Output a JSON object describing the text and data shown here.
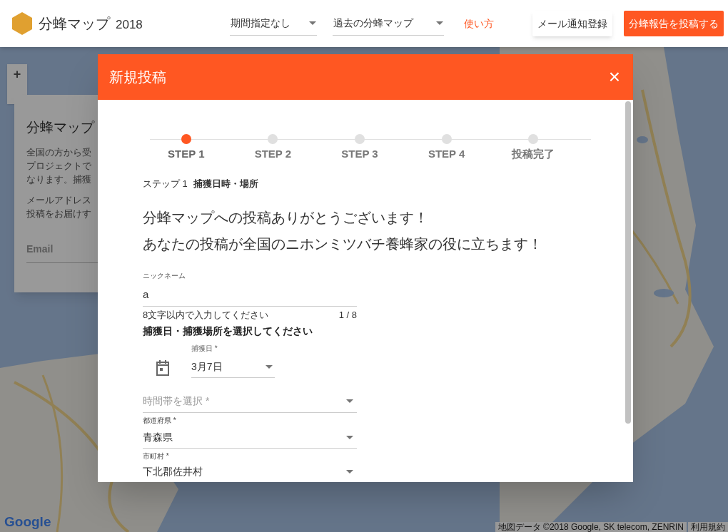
{
  "header": {
    "title": "分蜂マップ",
    "year": "2018",
    "filters": [
      {
        "label": "期間指定なし"
      },
      {
        "label": "過去の分蜂マップ"
      }
    ],
    "help_link": "使い方",
    "buttons": [
      {
        "label": "メール通知登録",
        "kind": "outlined"
      },
      {
        "label": "分蜂報告を投稿する",
        "kind": "primary"
      }
    ]
  },
  "map": {
    "zoom_controls": [
      "+"
    ],
    "logo": "Google",
    "attribution": "地図データ ©2018 Google, SK telecom, ZENRIN",
    "terms": "利用規約"
  },
  "info_card": {
    "title": "分蜂マップ",
    "paragraphs": [
      [
        "全国の方から受",
        "プロジェクトで",
        "なります。捕獲"
      ],
      [
        "メールアドレス",
        "投稿をお届けす"
      ]
    ],
    "email_placeholder": "Email"
  },
  "dialog": {
    "title": "新規投稿",
    "close": "×",
    "steps": [
      {
        "label": "STEP 1",
        "selected": true
      },
      {
        "label": "STEP 2",
        "selected": false
      },
      {
        "label": "STEP 3",
        "selected": false
      },
      {
        "label": "STEP 4",
        "selected": false
      },
      {
        "label": "投稿完了",
        "selected": false
      }
    ],
    "step_caption": {
      "prefix": "ステップ 1",
      "title": "捕獲日時・場所"
    },
    "message": [
      "分蜂マップへの投稿ありがとうございます！",
      "あなたの投稿が全国のニホンミツバチ養蜂家の役に立ちます！"
    ],
    "nickname": {
      "label": "ニックネーム",
      "value": "a",
      "hint": "8文字以内で入力してください",
      "counter": "1 / 8"
    },
    "section_title": "捕獲日・捕獲場所を選択してください",
    "date": {
      "label": "捕獲日 *",
      "value": "3月7日"
    },
    "time": {
      "placeholder": "時間帯を選択 *"
    },
    "prefecture": {
      "label": "都道府県 *",
      "value": "青森県"
    },
    "city": {
      "label": "市町村 *",
      "value": "下北郡佐井村"
    }
  }
}
